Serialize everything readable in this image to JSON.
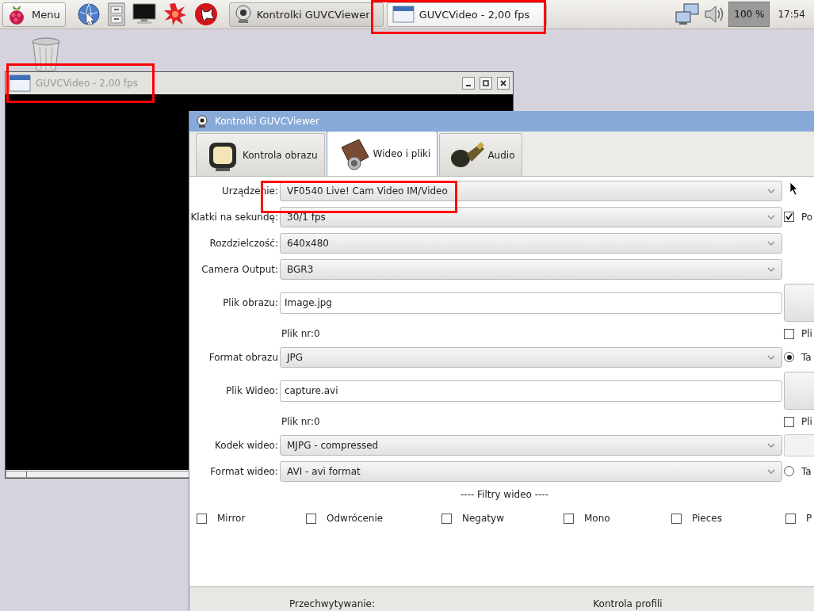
{
  "taskbar": {
    "menu_label": "Menu",
    "tasks": [
      {
        "title": "Kontrolki GUVCViewer",
        "selected": false
      },
      {
        "title": "GUVCVideo - 2,00 fps",
        "selected": true
      }
    ],
    "volume_level": "100 %",
    "clock": "17:54"
  },
  "video_window": {
    "title": "GUVCVideo - 2,00 fps"
  },
  "controls_window": {
    "title": "Kontrolki GUVCViewer",
    "tabs": [
      {
        "label": "Kontrola obrazu",
        "selected": false
      },
      {
        "label": "Wideo i pliki",
        "selected": true
      },
      {
        "label": "Audio",
        "selected": false
      }
    ],
    "rows": [
      {
        "kind": "combo",
        "label": "Urządzenie:",
        "value": "VF0540 Live! Cam Video IM/Video"
      },
      {
        "kind": "combo",
        "label": "Klatki na sekundę:",
        "value": "30/1 fps",
        "side": {
          "kind": "checkbox",
          "label": "Po",
          "checked": true
        }
      },
      {
        "kind": "combo",
        "label": "Rozdzielczość:",
        "value": "640x480"
      },
      {
        "kind": "combo",
        "label": "Camera Output:",
        "value": "BGR3"
      },
      {
        "kind": "entry",
        "label": "Plik obrazu:",
        "value": "Image.jpg",
        "side": {
          "kind": "button"
        }
      },
      {
        "kind": "note",
        "value": "Plik nr:0",
        "side": {
          "kind": "checkbox",
          "label": "Pli",
          "checked": false
        }
      },
      {
        "kind": "combo",
        "label": "Format obrazu",
        "value": "JPG",
        "side": {
          "kind": "radio",
          "label": "Ta",
          "selected": true
        }
      },
      {
        "kind": "entry",
        "label": "Plik Wideo:",
        "value": "capture.avi",
        "side": {
          "kind": "button"
        }
      },
      {
        "kind": "note",
        "value": "Plik nr:0",
        "side": {
          "kind": "checkbox",
          "label": "Pli",
          "checked": false
        }
      },
      {
        "kind": "combo",
        "label": "Kodek wideo:",
        "value": "MJPG - compressed",
        "side": {
          "kind": "field"
        }
      },
      {
        "kind": "combo",
        "label": "Format wideo:",
        "value": "AVI - avi format",
        "side": {
          "kind": "radio",
          "label": "Ta",
          "selected": false
        }
      }
    ],
    "filters_heading": "---- Filtry wideo ----",
    "filters": [
      {
        "label": "Mirror",
        "checked": false
      },
      {
        "label": "Odwrócenie",
        "checked": false
      },
      {
        "label": "Negatyw",
        "checked": false
      },
      {
        "label": "Mono",
        "checked": false
      },
      {
        "label": "Pieces",
        "checked": false
      },
      {
        "label": "P",
        "checked": false
      }
    ],
    "status": {
      "capture_label": "Przechwytywanie:",
      "profile_label": "Kontrola profili"
    }
  }
}
